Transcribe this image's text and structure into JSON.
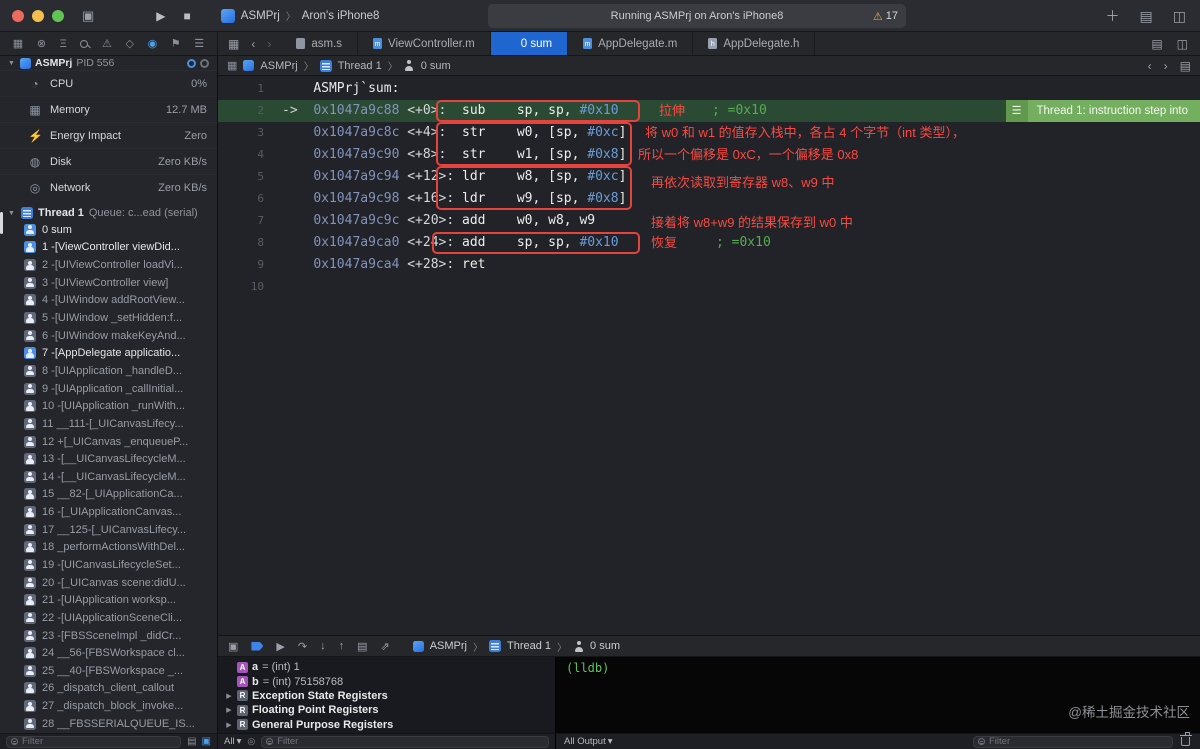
{
  "icons": {
    "panes": "▣",
    "run": "▶",
    "stop": "■",
    "chev": "〉",
    "plus": "＋",
    "library": "▤",
    "panel": "◫",
    "warning": "⚠",
    "nav_project": "▦",
    "nav_scm": "⊗",
    "nav_symbol": "Ξ",
    "nav_issue": "⚠",
    "nav_test": "◇",
    "nav_debug": "◉",
    "nav_breakpoint": "⚑",
    "nav_report": "☰",
    "back": "‹",
    "forward": "›",
    "related": "▦",
    "list": "▤",
    "split": "◫",
    "banner_menu": "☰",
    "hide_debug": "▣",
    "continue": "▶",
    "step_over": "↷",
    "step_into": "↓",
    "step_out": "↑",
    "hierarchy": "▤",
    "location": "⇗",
    "dropdown": "▾",
    "disclosure_open": "▼"
  },
  "toolbar": {
    "scheme": "ASMPrj",
    "device": "Aron's iPhone8",
    "status_text": "Running ASMPrj on Aron's iPhone8",
    "warning_count": "17"
  },
  "tabs": [
    {
      "label": "asm.s",
      "kind": "doc",
      "letter": "",
      "cls": ""
    },
    {
      "label": "ViewController.m",
      "kind": "m",
      "letter": "m",
      "cls": ""
    },
    {
      "label": "0 sum",
      "kind": "person",
      "letter": "",
      "cls": "active"
    },
    {
      "label": "AppDelegate.m",
      "kind": "m",
      "letter": "m",
      "cls": ""
    },
    {
      "label": "AppDelegate.h",
      "kind": "h",
      "letter": "h",
      "cls": ""
    }
  ],
  "jumpbar": {
    "project": "ASMPrj",
    "thread": "Thread 1",
    "frame": "0 sum"
  },
  "sidebar": {
    "process": {
      "name": "ASMPrj",
      "pid": "PID 556"
    },
    "gauges": [
      {
        "label": "CPU",
        "value": "0%",
        "glyph": "◔"
      },
      {
        "label": "Memory",
        "value": "12.7 MB",
        "glyph": "▦"
      },
      {
        "label": "Energy Impact",
        "value": "Zero",
        "glyph": "⚡"
      },
      {
        "label": "Disk",
        "value": "Zero KB/s",
        "glyph": "◍"
      },
      {
        "label": "Network",
        "value": "Zero KB/s",
        "glyph": "◎"
      }
    ],
    "thread": {
      "name": "Thread 1",
      "detail": "Queue: c...ead (serial)"
    },
    "frames": [
      {
        "label": "0 sum",
        "cls": "user"
      },
      {
        "label": "1 -[ViewController viewDid...",
        "cls": "user"
      },
      {
        "label": "2 -[UIViewController loadVi...",
        "cls": "sys"
      },
      {
        "label": "3 -[UIViewController view]",
        "cls": "sys"
      },
      {
        "label": "4 -[UIWindow addRootView...",
        "cls": "sys"
      },
      {
        "label": "5 -[UIWindow _setHidden:f...",
        "cls": "sys"
      },
      {
        "label": "6 -[UIWindow makeKeyAnd...",
        "cls": "sys"
      },
      {
        "label": "7 -[AppDelegate applicatio...",
        "cls": "user"
      },
      {
        "label": "8 -[UIApplication _handleD...",
        "cls": "sys"
      },
      {
        "label": "9 -[UIApplication _callInitial...",
        "cls": "sys"
      },
      {
        "label": "10 -[UIApplication _runWith...",
        "cls": "sys"
      },
      {
        "label": "11 __111-[_UICanvasLifecy...",
        "cls": "sys"
      },
      {
        "label": "12 +[_UICanvas _enqueueP...",
        "cls": "sys"
      },
      {
        "label": "13 -[__UICanvasLifecycleM...",
        "cls": "sys"
      },
      {
        "label": "14 -[__UICanvasLifecycleM...",
        "cls": "sys"
      },
      {
        "label": "15 __82-[_UIApplicationCa...",
        "cls": "sys"
      },
      {
        "label": "16 -[_UIApplicationCanvas...",
        "cls": "sys"
      },
      {
        "label": "17 __125-[_UICanvasLifecy...",
        "cls": "sys"
      },
      {
        "label": "18 _performActionsWithDel...",
        "cls": "sys"
      },
      {
        "label": "19 -[UICanvasLifecycleSet...",
        "cls": "sys"
      },
      {
        "label": "20 -[_UICanvas scene:didU...",
        "cls": "sys"
      },
      {
        "label": "21 -[UIApplication worksp...",
        "cls": "sys"
      },
      {
        "label": "22 -[UIApplicationSceneCli...",
        "cls": "sys"
      },
      {
        "label": "23 -[FBSSceneImpl _didCr...",
        "cls": "sys"
      },
      {
        "label": "24 __56-[FBSWorkspace cl...",
        "cls": "sys"
      },
      {
        "label": "25 __40-[FBSWorkspace _...",
        "cls": "sys"
      },
      {
        "label": "26 _dispatch_client_callout",
        "cls": "sys"
      },
      {
        "label": "27 _dispatch_block_invoke...",
        "cls": "sys"
      },
      {
        "label": "28 __FBSSERIALQUEUE_IS...",
        "cls": "sys"
      }
    ],
    "filter_placeholder": "Filter"
  },
  "editor": {
    "lines": [
      {
        "num": "1",
        "segs": [
          {
            "t": "    ",
            "c": "op"
          },
          {
            "t": "ASMPrj`sum:",
            "c": "sym"
          }
        ]
      },
      {
        "num": "2",
        "cls": "current",
        "segs": [
          {
            "t": "->  ",
            "c": "arrow"
          },
          {
            "t": "0x1047a9c88 ",
            "c": "addr"
          },
          {
            "t": "<+0>:  ",
            "c": "off"
          },
          {
            "t": "sub    ",
            "c": "mn"
          },
          {
            "t": "sp, sp, ",
            "c": "op"
          },
          {
            "t": "#0x10",
            "c": "imm"
          }
        ]
      },
      {
        "num": "3",
        "segs": [
          {
            "t": "    ",
            "c": "op"
          },
          {
            "t": "0x1047a9c8c ",
            "c": "addr"
          },
          {
            "t": "<+4>:  ",
            "c": "off"
          },
          {
            "t": "str    ",
            "c": "mn"
          },
          {
            "t": "w0, [sp, ",
            "c": "op"
          },
          {
            "t": "#0xc",
            "c": "imm"
          },
          {
            "t": "]",
            "c": "op"
          }
        ]
      },
      {
        "num": "4",
        "segs": [
          {
            "t": "    ",
            "c": "op"
          },
          {
            "t": "0x1047a9c90 ",
            "c": "addr"
          },
          {
            "t": "<+8>:  ",
            "c": "off"
          },
          {
            "t": "str    ",
            "c": "mn"
          },
          {
            "t": "w1, [sp, ",
            "c": "op"
          },
          {
            "t": "#0x8",
            "c": "imm"
          },
          {
            "t": "]",
            "c": "op"
          }
        ]
      },
      {
        "num": "5",
        "segs": [
          {
            "t": "    ",
            "c": "op"
          },
          {
            "t": "0x1047a9c94 ",
            "c": "addr"
          },
          {
            "t": "<+12>: ",
            "c": "off"
          },
          {
            "t": "ldr    ",
            "c": "mn"
          },
          {
            "t": "w8, [sp, ",
            "c": "op"
          },
          {
            "t": "#0xc",
            "c": "imm"
          },
          {
            "t": "]",
            "c": "op"
          }
        ]
      },
      {
        "num": "6",
        "segs": [
          {
            "t": "    ",
            "c": "op"
          },
          {
            "t": "0x1047a9c98 ",
            "c": "addr"
          },
          {
            "t": "<+16>: ",
            "c": "off"
          },
          {
            "t": "ldr    ",
            "c": "mn"
          },
          {
            "t": "w9, [sp, ",
            "c": "op"
          },
          {
            "t": "#0x8",
            "c": "imm"
          },
          {
            "t": "]",
            "c": "op"
          }
        ]
      },
      {
        "num": "7",
        "segs": [
          {
            "t": "    ",
            "c": "op"
          },
          {
            "t": "0x1047a9c9c ",
            "c": "addr"
          },
          {
            "t": "<+20>: ",
            "c": "off"
          },
          {
            "t": "add    ",
            "c": "mn"
          },
          {
            "t": "w0, w8, w9",
            "c": "op"
          }
        ]
      },
      {
        "num": "8",
        "segs": [
          {
            "t": "    ",
            "c": "op"
          },
          {
            "t": "0x1047a9ca0 ",
            "c": "addr"
          },
          {
            "t": "<+24>: ",
            "c": "off"
          },
          {
            "t": "add    ",
            "c": "mn"
          },
          {
            "t": "sp, sp, ",
            "c": "op"
          },
          {
            "t": "#0x10",
            "c": "imm"
          }
        ]
      },
      {
        "num": "9",
        "segs": [
          {
            "t": "    ",
            "c": "op"
          },
          {
            "t": "0x1047a9ca4 ",
            "c": "addr"
          },
          {
            "t": "<+28>: ",
            "c": "off"
          },
          {
            "t": "ret",
            "c": "mn"
          }
        ]
      },
      {
        "num": "10",
        "segs": []
      }
    ],
    "banner_text": "Thread 1: instruction step into",
    "annotations": {
      "stretch": "拉伸",
      "comment1": "; =0x10",
      "store_line1": "将 w0 和 w1 的值存入栈中，各占 4 个字节（int 类型），",
      "store_line2": "所以一个偏移是 0xC，一个偏移是 0x8",
      "load": "再依次读取到寄存器 w8、w9 中",
      "addnote": "接着将 w8+w9 的结果保存到 w0 中",
      "restore": "恢复",
      "comment2": "; =0x10"
    }
  },
  "debugbar": {
    "project": "ASMPrj",
    "thread": "Thread 1",
    "frame": "0 sum"
  },
  "variables": {
    "rows": [
      {
        "tri": "",
        "letter": "A",
        "cls": "var",
        "name": "a",
        "value": "= (int) 1"
      },
      {
        "tri": "",
        "letter": "A",
        "cls": "var",
        "name": "b",
        "value": "= (int) 75158768"
      },
      {
        "tri": "▶",
        "letter": "R",
        "cls": "reg",
        "name": "Exception State Registers",
        "value": ""
      },
      {
        "tri": "▶",
        "letter": "R",
        "cls": "reg",
        "name": "Floating Point Registers",
        "value": ""
      },
      {
        "tri": "▶",
        "letter": "R",
        "cls": "reg",
        "name": "General Purpose Registers",
        "value": ""
      }
    ],
    "scope": "All",
    "filter_placeholder": "Filter"
  },
  "console": {
    "prompt": "(lldb)",
    "output_scope": "All Output",
    "filter_placeholder": "Filter"
  },
  "watermark": "@稀土掘金技术社区"
}
